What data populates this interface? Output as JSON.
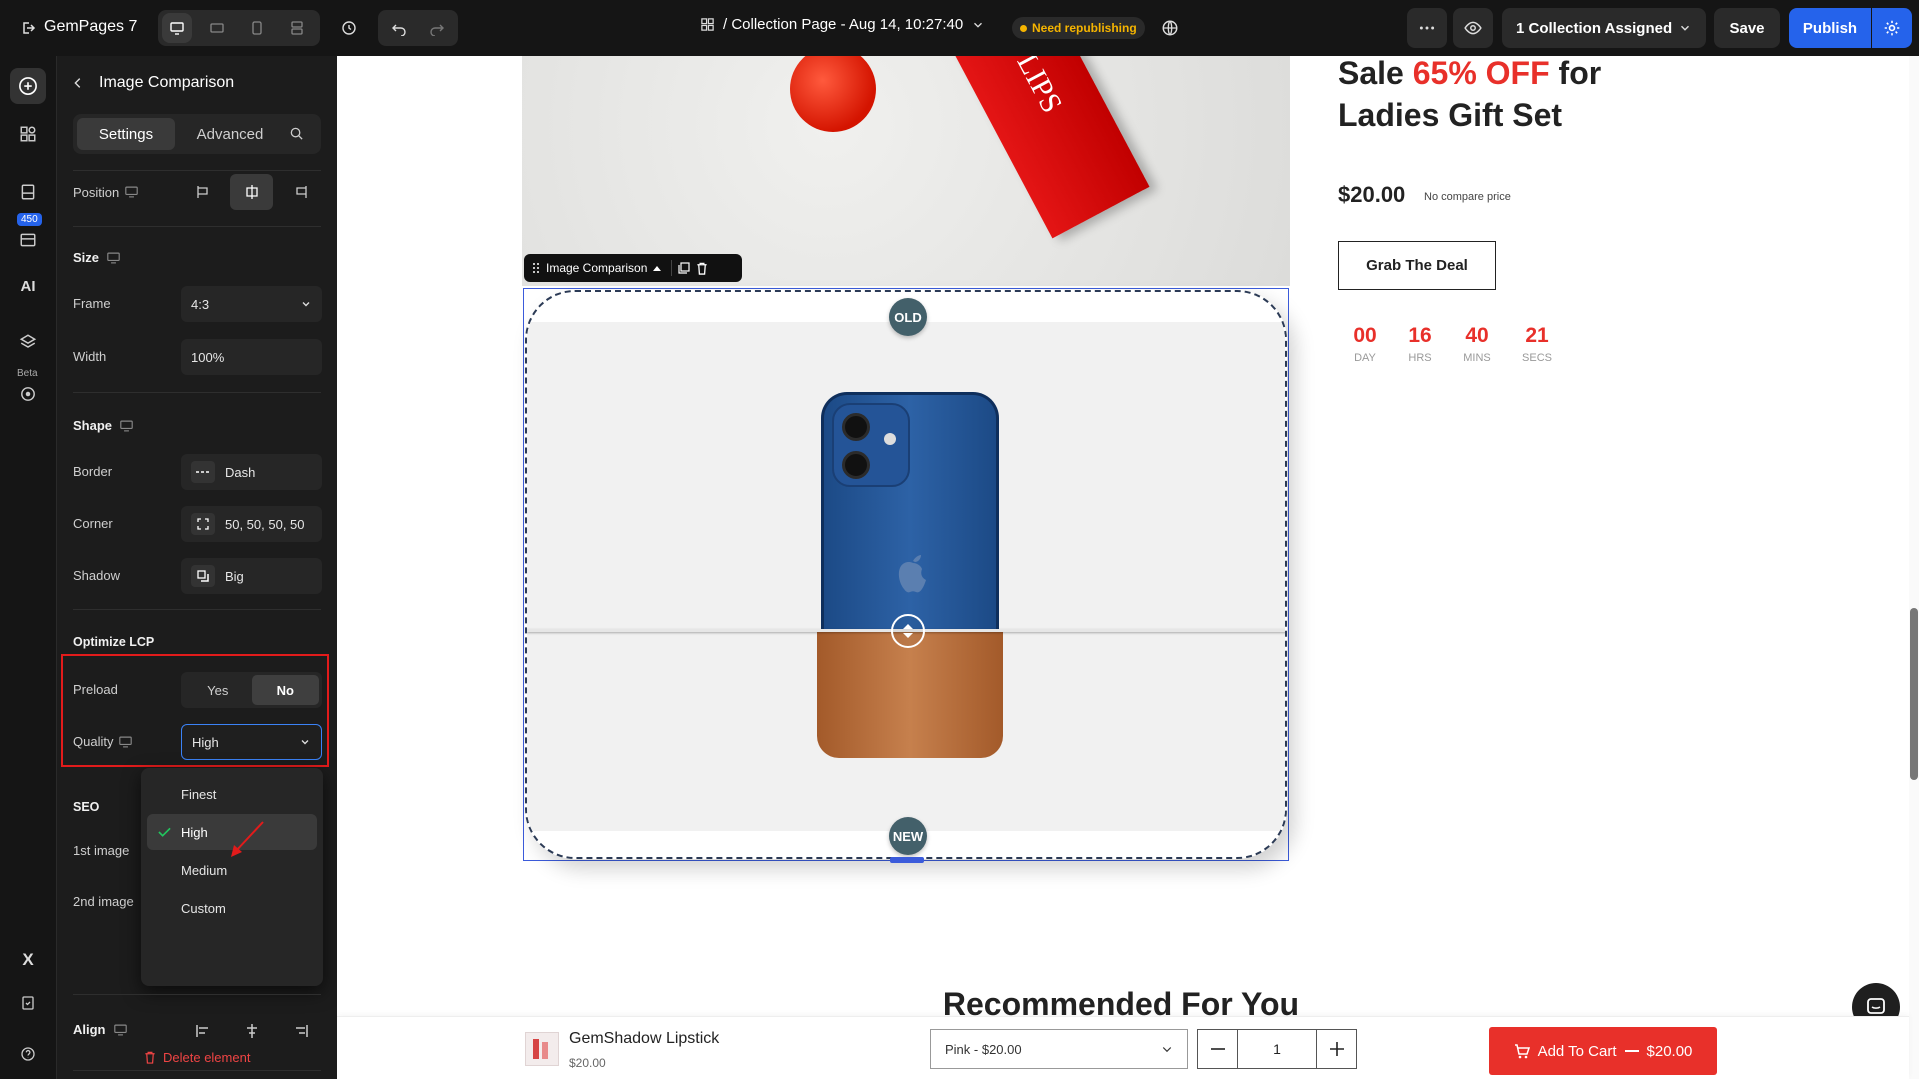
{
  "topbar": {
    "app_name": "GemPages 7",
    "page_title": "/ Collection Page - Aug 14, 10:27:40",
    "status_badge": "Need republishing",
    "collection_assigned": "1 Collection Assigned",
    "save_label": "Save",
    "publish_label": "Publish"
  },
  "rail": {
    "badge_count": "450",
    "beta_label": "Beta"
  },
  "panel": {
    "title": "Image Comparison",
    "tabs": [
      "Settings",
      "Advanced"
    ],
    "position_label": "Position",
    "size_section": "Size",
    "frame_label": "Frame",
    "frame_value": "4:3",
    "width_label": "Width",
    "width_value": "100%",
    "shape_section": "Shape",
    "border_label": "Border",
    "border_value": "Dash",
    "corner_label": "Corner",
    "corner_value": "50, 50, 50, 50",
    "shadow_label": "Shadow",
    "shadow_value": "Big",
    "lcp_section": "Optimize LCP",
    "preload_label": "Preload",
    "preload_yes": "Yes",
    "preload_no": "No",
    "quality_label": "Quality",
    "quality_value": "High",
    "quality_options": [
      "Finest",
      "High",
      "Medium",
      "Custom"
    ],
    "seo_section": "SEO",
    "first_image_label": "1st image",
    "second_image_label": "2nd image",
    "align_section": "Align",
    "delete_label": "Delete element"
  },
  "canvas": {
    "product_title_1": "Sale ",
    "product_title_highlight": "65% OFF",
    "product_title_2": " for",
    "product_title_line2": "Ladies Gift Set",
    "price": "$20.00",
    "compare_price": "No compare price",
    "grab_button": "Grab The Deal",
    "countdown": [
      {
        "value": "00",
        "unit": "DAY"
      },
      {
        "value": "16",
        "unit": "HRS"
      },
      {
        "value": "40",
        "unit": "MINS"
      },
      {
        "value": "21",
        "unit": "SECS"
      }
    ],
    "element_toolbar_label": "Image Comparison",
    "old_label": "OLD",
    "new_label": "NEW",
    "recommended_heading": "Recommended For You",
    "sticky_product_name": "GemShadow Lipstick",
    "sticky_product_price": "$20.00",
    "variant_select": "Pink - $20.00",
    "quantity": "1",
    "add_to_cart": "Add To Cart",
    "add_to_cart_price": "$20.00"
  },
  "colors": {
    "accent_red": "#e8302a",
    "publish_blue": "#2563eb",
    "badge_yellow": "#f5b400",
    "highlight_box": "#e21b1b"
  }
}
